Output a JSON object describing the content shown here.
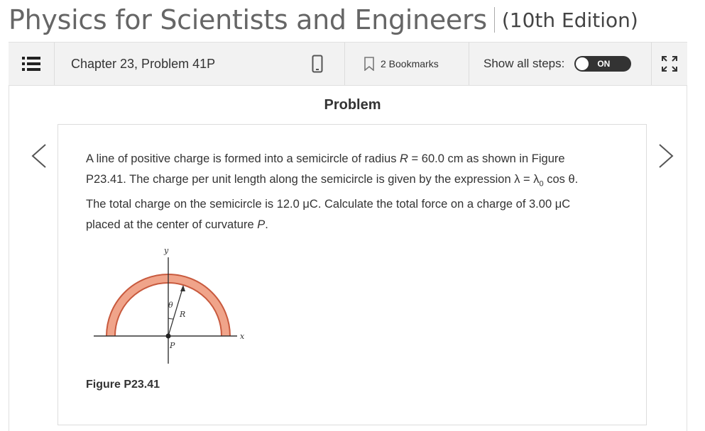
{
  "header": {
    "book_title": "Physics for Scientists and Engineers",
    "edition": "(10th Edition)"
  },
  "toolbar": {
    "menu_icon": "list-icon",
    "chapter_problem": "Chapter 23, Problem 41P",
    "device_icon": "mobile-device-icon",
    "bookmark_icon": "bookmark-icon",
    "bookmarks_label": "2 Bookmarks",
    "show_steps_label": "Show all steps:",
    "show_steps_toggle": "ON",
    "expand_icon": "expand-arrows-icon"
  },
  "content": {
    "heading": "Problem",
    "prev_icon": "chevron-left-icon",
    "next_icon": "chevron-right-icon",
    "problem": {
      "line1_a": "A line of positive charge is formed into a semicircle of radius ",
      "line1_R": "R",
      "line1_b": " = 60.0 cm as shown in Figure",
      "line2_a": "P23.41. The charge per unit length along the semicircle is given by the expression λ = λ",
      "line2_sub": "0",
      "line2_b": " cos θ.",
      "line3": "The total charge on the semicircle is 12.0 μC. Calculate the total force on a charge of 3.00 μC",
      "line4_a": "placed at the center of curvature ",
      "line4_P": "P",
      "line4_b": "."
    },
    "figure": {
      "label_y": "y",
      "label_x": "x",
      "label_theta": "θ",
      "label_R": "R",
      "label_P": "P",
      "arc_color": "#e8826a"
    },
    "figure_caption": "Figure P23.41"
  }
}
